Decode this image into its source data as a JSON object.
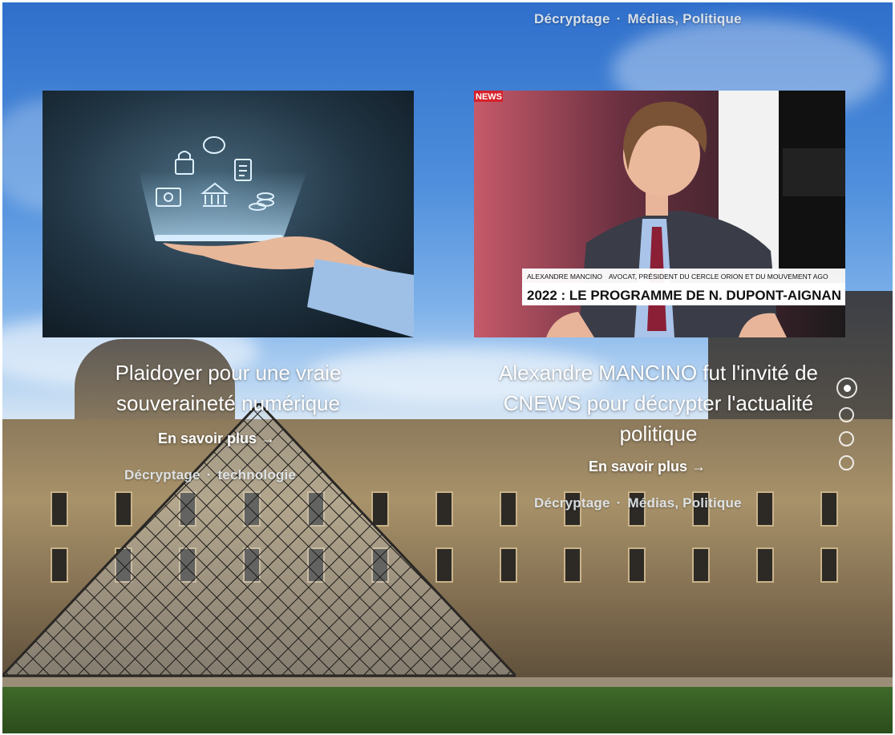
{
  "top_meta": {
    "category": "Décryptage",
    "tags": "Médias, Politique",
    "separator": "·"
  },
  "articles": [
    {
      "title": "Plaidoyer pour une vraie souveraineté numérique",
      "more_label": "En savoir plus →",
      "category": "Décryptage",
      "tags": "technologie",
      "image": "hand-holding-phone-with-finance-icons"
    },
    {
      "title": "Alexandre MANCINO fut l'invité de CNEWS pour décrypter l'actualité politique",
      "more_label": "En savoir plus →",
      "category": "Décryptage",
      "tags": "Médias, Politique",
      "image": "cnews-tv-interview",
      "tv": {
        "channel": "NEWS",
        "name": "ALEXANDRE MANCINO",
        "role": "AVOCAT, PRÉSIDENT DU CERCLE ORION ET DU MOUVEMENT AGO",
        "headline": "2022 : LE PROGRAMME DE N. DUPONT-AIGNAN"
      }
    }
  ],
  "slider": {
    "count": 4,
    "active": 0
  },
  "colors": {
    "accent": "#ffffff",
    "tv_red": "#d6202a",
    "sky": "#3f80d6"
  }
}
